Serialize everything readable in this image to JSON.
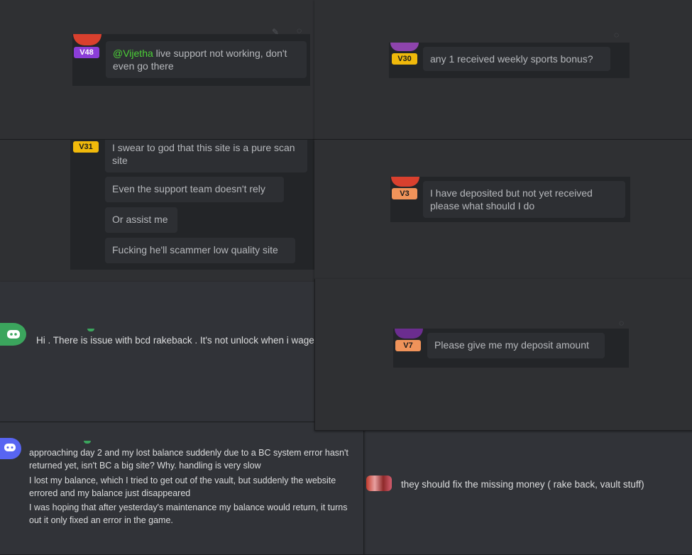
{
  "panels": {
    "v48": {
      "badge": "V48",
      "mention": "@Vijetha",
      "message": " live support not working, don't even go there"
    },
    "v30": {
      "badge": "V30",
      "message": "any 1 received weekly sports bonus?"
    },
    "v31": {
      "badge": "V31",
      "messages": [
        "I swear to god that this site is a pure scan site",
        "Even the support team doesn't rely",
        "Or assist me",
        "Fucking he'll scammer low quality site"
      ]
    },
    "v3": {
      "badge": "V3",
      "message": "I have deposited but not yet received please what should I do"
    },
    "v7": {
      "badge": "V7",
      "message": "Please give me my deposit amount"
    },
    "discord1": {
      "message": "Hi .  There is issue with bcd rakeback . It's not unlock when i wage"
    },
    "discord2": {
      "messages": [
        "approaching day 2 and my lost balance suddenly due to a BC system error hasn't returned yet, isn't BC a big site? Why. handling is very slow",
        "I lost my balance, which I tried to get out of the vault, but suddenly the website errored and my balance just disappeared",
        "I was hoping that after yesterday's maintenance my balance would return, it turns out it only fixed an error in the game."
      ]
    },
    "discord3": {
      "message": "they should fix the missing money ( rake back, vault stuff)"
    }
  },
  "colors": {
    "badge_purple": "#8b3dd8",
    "badge_yellow": "#f0b90b",
    "badge_orange": "#f0935a",
    "mention_green": "#4cd137",
    "discord_green": "#3ba55d",
    "discord_blurple": "#5865f2"
  },
  "icons": [
    "discord-avatar-icon",
    "edit-icon",
    "more-icon"
  ]
}
